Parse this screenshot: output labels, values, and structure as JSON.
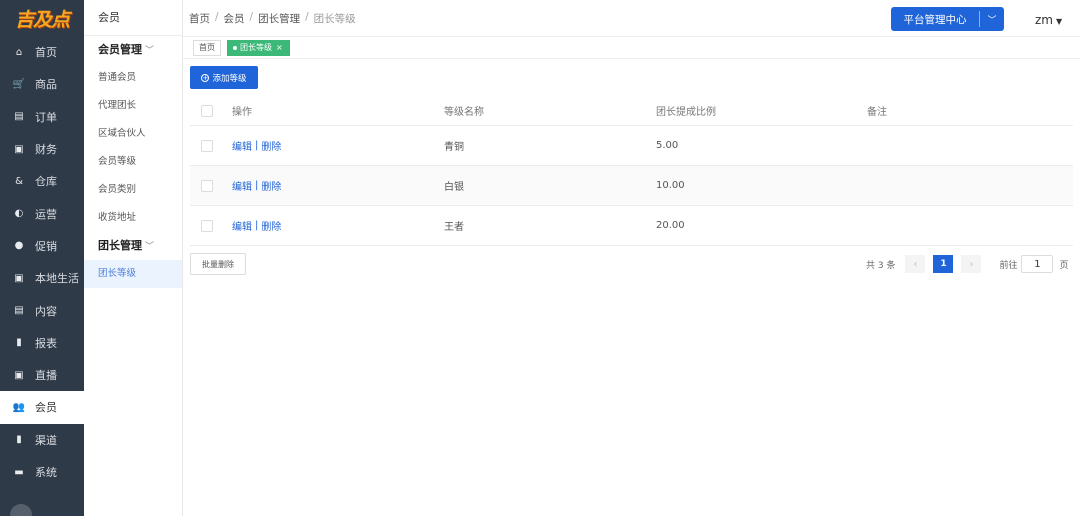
{
  "brand": {
    "logo_text": "吉及点"
  },
  "nav": {
    "items": [
      {
        "label": "首页",
        "icon": "home-icon",
        "glyph": "⌂"
      },
      {
        "label": "商品",
        "icon": "cart-icon",
        "glyph": "🛒"
      },
      {
        "label": "订单",
        "icon": "order-icon",
        "glyph": "▤"
      },
      {
        "label": "财务",
        "icon": "finance-icon",
        "glyph": "▣"
      },
      {
        "label": "仓库",
        "icon": "warehouse-icon",
        "glyph": "&"
      },
      {
        "label": "运营",
        "icon": "operations-icon",
        "glyph": "◐"
      },
      {
        "label": "促销",
        "icon": "promotion-icon",
        "glyph": "●"
      },
      {
        "label": "本地生活",
        "icon": "local-life-icon",
        "glyph": "▣"
      },
      {
        "label": "内容",
        "icon": "content-icon",
        "glyph": "▤"
      },
      {
        "label": "报表",
        "icon": "report-icon",
        "glyph": "▮"
      },
      {
        "label": "直播",
        "icon": "live-icon",
        "glyph": "▣"
      },
      {
        "label": "会员",
        "icon": "member-icon",
        "glyph": "👥",
        "active": true
      },
      {
        "label": "渠道",
        "icon": "channel-icon",
        "glyph": "▮"
      },
      {
        "label": "系统",
        "icon": "system-icon",
        "glyph": "▬"
      }
    ]
  },
  "subnav": {
    "title": "会员",
    "group1": {
      "title": "会员管理",
      "items": [
        "普通会员",
        "代理团长",
        "区域合伙人",
        "会员等级",
        "会员类别",
        "收货地址"
      ]
    },
    "group2": {
      "title": "团长管理",
      "items": [
        "团长等级"
      ]
    }
  },
  "header": {
    "breadcrumb": [
      "首页",
      "会员",
      "团长管理",
      "团长等级"
    ],
    "platform_button": "平台管理中心",
    "user": "zm"
  },
  "tags": {
    "home": "首页",
    "active": "团长等级",
    "close": "×"
  },
  "toolbar": {
    "add_label": "添加等级",
    "batch_delete": "批量删除"
  },
  "table": {
    "columns": [
      "操作",
      "等级名称",
      "团长提成比例",
      "备注"
    ],
    "edit_label": "编辑",
    "delete_label": "删除",
    "rows": [
      {
        "name": "青铜",
        "rate": "5.00",
        "note": ""
      },
      {
        "name": "白银",
        "rate": "10.00",
        "note": ""
      },
      {
        "name": "王者",
        "rate": "20.00",
        "note": ""
      }
    ]
  },
  "pagination": {
    "total": "共 3 条",
    "current_page": "1",
    "goto_label": "前往",
    "goto_value": "1",
    "unit": "页"
  }
}
